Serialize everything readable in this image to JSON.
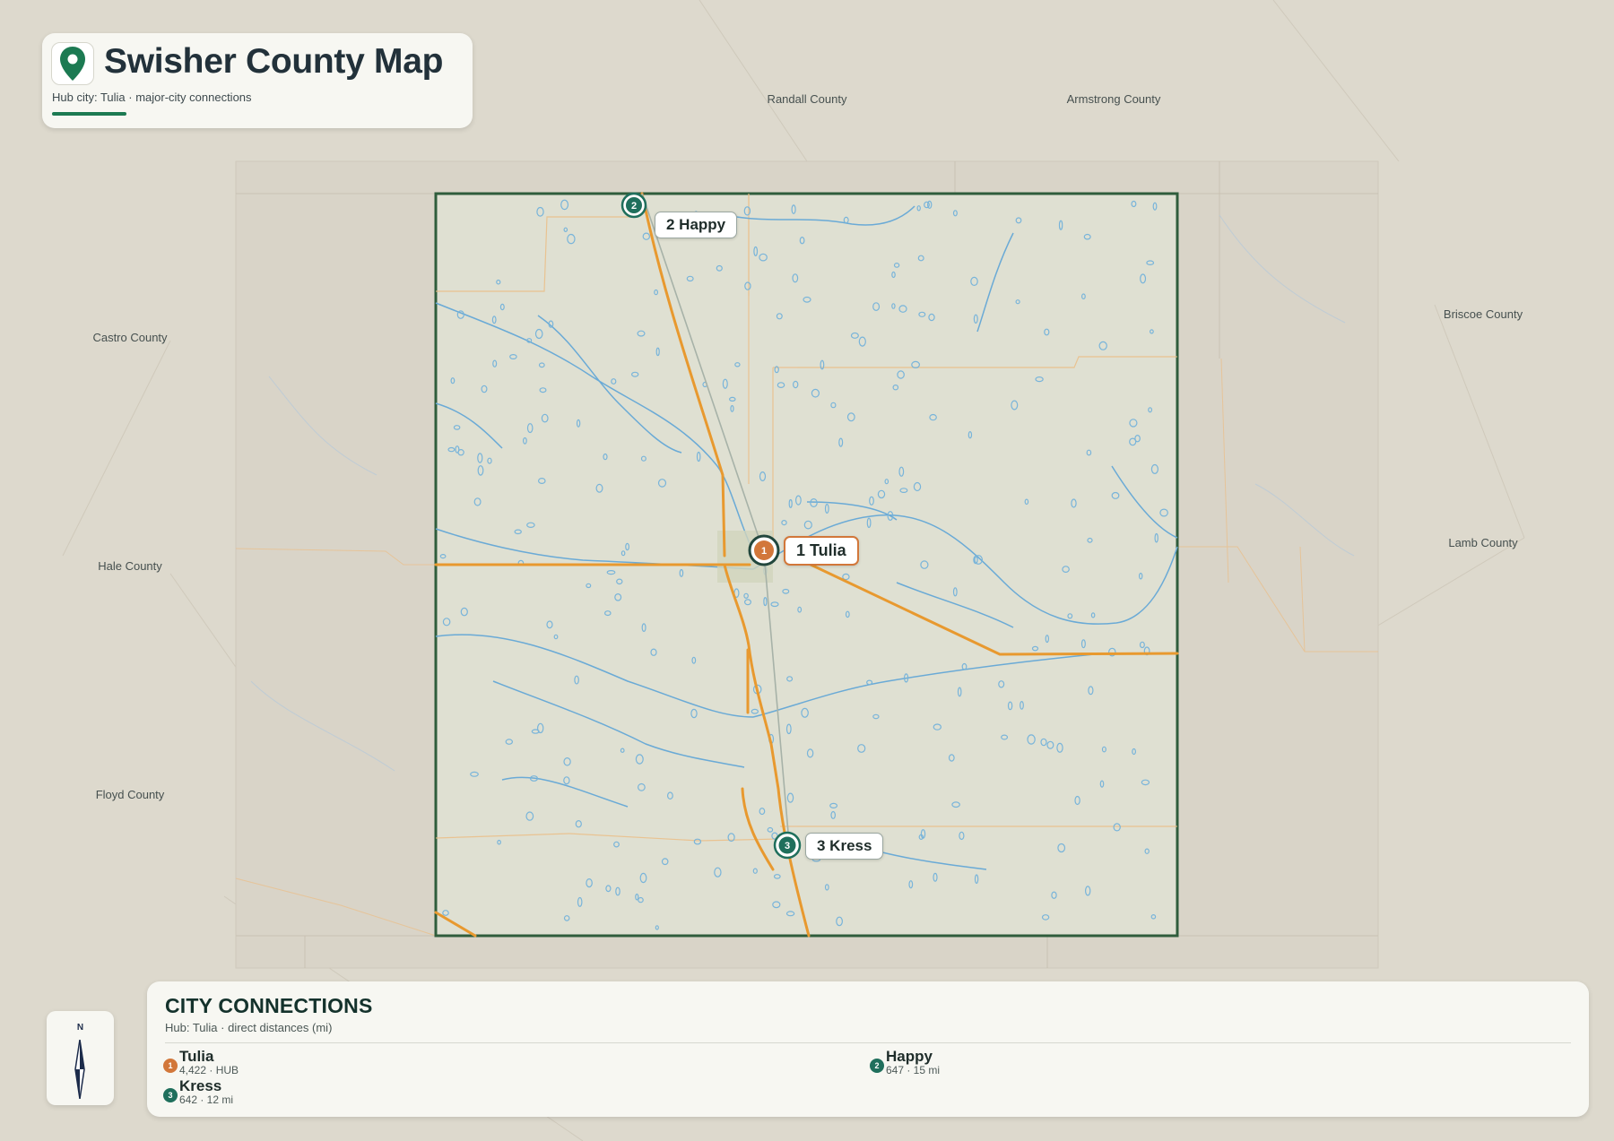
{
  "title": {
    "text": "Swisher County Map",
    "subtitle": "Hub city: Tulia · major-city connections"
  },
  "colors": {
    "background": "#ddd9cd",
    "county_fill": "#dfe0d2",
    "county_border": "#2f5d3c",
    "highway": "#e8992f",
    "water": "#6aaad6",
    "hub": "#d2773a",
    "city": "#1f6f5c",
    "accent": "#1c7a52"
  },
  "map": {
    "neighbors": [
      {
        "id": "randall",
        "name": "Randall County"
      },
      {
        "id": "armstrong",
        "name": "Armstrong County"
      },
      {
        "id": "briscoe",
        "name": "Briscoe County"
      },
      {
        "id": "castro",
        "name": "Castro County"
      },
      {
        "id": "hale",
        "name": "Hale County"
      },
      {
        "id": "floyd",
        "name": "Floyd County"
      },
      {
        "id": "lamb",
        "name": "Lamb County"
      }
    ],
    "cities": [
      {
        "id": "tulia",
        "rank": "1",
        "name": "Tulia",
        "label": "1 Tulia",
        "population": "4,422",
        "role": "hub"
      },
      {
        "id": "happy",
        "rank": "2",
        "name": "Happy",
        "label": "2 Happy",
        "population": "647",
        "distance_mi": 15
      },
      {
        "id": "kress",
        "rank": "3",
        "name": "Kress",
        "label": "3 Kress",
        "population": "642",
        "distance_mi": 12
      }
    ],
    "compass": {
      "north_label": "N"
    }
  },
  "panel": {
    "title": "CITY CONNECTIONS",
    "subtitle": "Hub: Tulia · direct distances (mi)",
    "entries": [
      {
        "rank": "1",
        "name": "Tulia",
        "meta": "4,422 · HUB",
        "type": "hub"
      },
      {
        "rank": "2",
        "name": "Happy",
        "meta": "647 · 15 mi",
        "type": "city"
      },
      {
        "rank": "3",
        "name": "Kress",
        "meta": "642 · 12 mi",
        "type": "city"
      }
    ]
  }
}
